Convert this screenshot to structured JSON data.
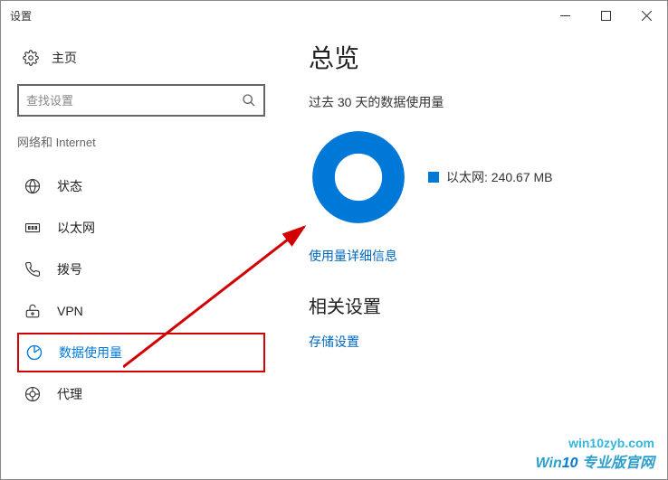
{
  "window": {
    "title": "设置"
  },
  "sidebar": {
    "home_label": "主页",
    "search_placeholder": "查找设置",
    "category_label": "网络和 Internet",
    "items": [
      {
        "label": "状态"
      },
      {
        "label": "以太网"
      },
      {
        "label": "拨号"
      },
      {
        "label": "VPN"
      },
      {
        "label": "数据使用量"
      },
      {
        "label": "代理"
      }
    ]
  },
  "main": {
    "title": "总览",
    "subtitle": "过去 30 天的数据使用量",
    "legend_label": "以太网: 240.67 MB",
    "details_link": "使用量详细信息",
    "related_heading": "相关设置",
    "storage_link": "存储设置"
  },
  "chart_data": {
    "type": "pie",
    "title": "过去 30 天的数据使用量",
    "series": [
      {
        "name": "以太网",
        "value_mb": 240.67,
        "color": "#0078d7"
      }
    ]
  },
  "watermark": {
    "url": "win10zyb.com",
    "brand_prefix": "Win",
    "brand_num": "10",
    "brand_suffix": " 专业版官网"
  }
}
